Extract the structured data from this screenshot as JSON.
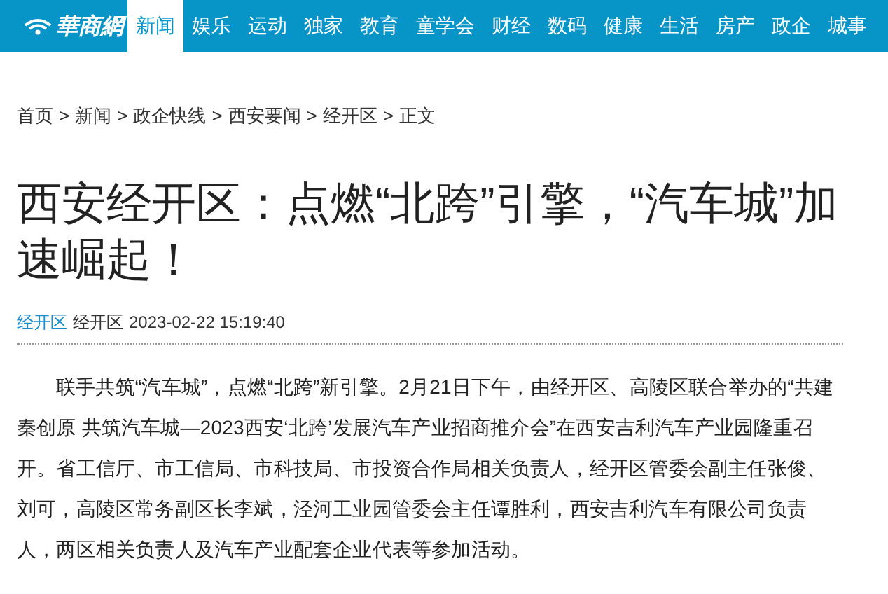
{
  "header": {
    "logo": "華商網",
    "nav": [
      {
        "label": "新闻",
        "selected": true
      },
      {
        "label": "娱乐",
        "selected": false
      },
      {
        "label": "运动",
        "selected": false
      },
      {
        "label": "独家",
        "selected": false
      },
      {
        "label": "教育",
        "selected": false
      },
      {
        "label": "童学会",
        "selected": false
      },
      {
        "label": "财经",
        "selected": false
      },
      {
        "label": "数码",
        "selected": false
      },
      {
        "label": "健康",
        "selected": false
      },
      {
        "label": "生活",
        "selected": false
      },
      {
        "label": "房产",
        "selected": false
      },
      {
        "label": "政企",
        "selected": false
      },
      {
        "label": "城事",
        "selected": false
      }
    ]
  },
  "breadcrumb": {
    "items": [
      "首页",
      "新闻",
      "政企快线",
      "西安要闻",
      "经开区",
      "正文"
    ],
    "separator": ">"
  },
  "article": {
    "title": "西安经开区：点燃“北跨”引擎，“汽车城”加速崛起！",
    "source_link": "经开区",
    "author": "经开区",
    "datetime": "2023-02-22 15:19:40",
    "body": "联手共筑“汽车城”，点燃“北跨”新引擎。2月21日下午，由经开区、高陵区联合举办的“共建秦创原 共筑汽车城—2023西安‘北跨’发展汽车产业招商推介会”在西安吉利汽车产业园隆重召开。省工信厅、市工信局、市科技局、市投资合作局相关负责人，经开区管委会副主任张俊、刘可，高陵区常务副区长李斌，泾河工业园管委会主任谭胜利，西安吉利汽车有限公司负责人，两区相关负责人及汽车产业配套企业代表等参加活动。"
  }
}
